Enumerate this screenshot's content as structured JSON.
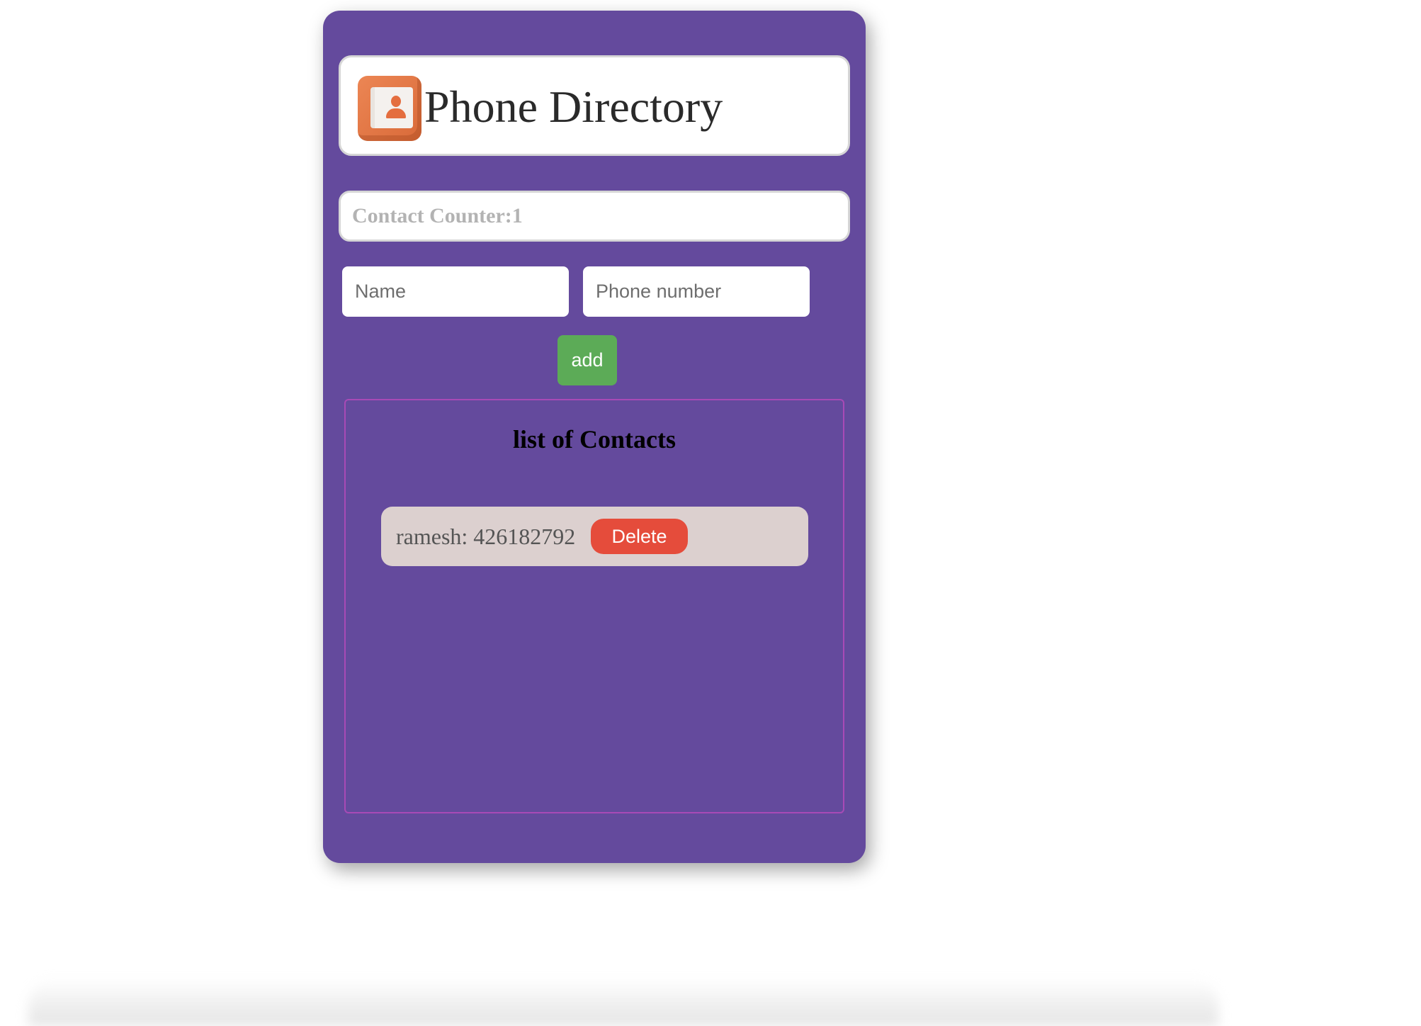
{
  "header": {
    "title": "Phone Directory",
    "logo_icon": "contact-book-icon"
  },
  "counter": {
    "label": "Contact Counter:1"
  },
  "form": {
    "name_placeholder": "Name",
    "name_value": "",
    "phone_placeholder": "Phone number",
    "phone_value": "",
    "add_label": "add"
  },
  "contacts": {
    "heading": "list of Contacts",
    "items": [
      {
        "text": "ramesh: 426182792",
        "delete_label": "Delete"
      }
    ]
  },
  "colors": {
    "card_background": "#644a9d",
    "add_button": "#5cab57",
    "delete_button": "#e54c3b",
    "contact_item": "#dcd0cf",
    "panel_border": "#a84ab6"
  }
}
